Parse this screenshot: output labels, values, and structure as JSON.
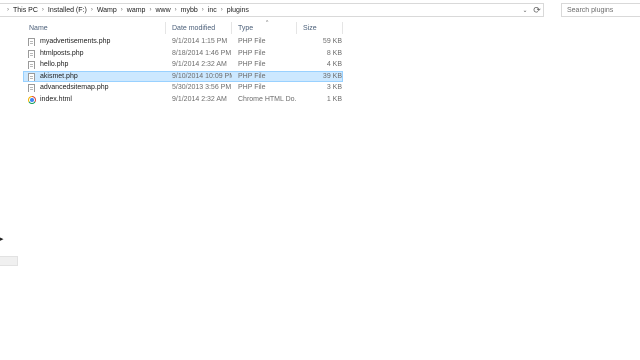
{
  "breadcrumbs": [
    "This PC",
    "Installed (F:)",
    "Wamp",
    "wamp",
    "www",
    "mybb",
    "inc",
    "plugins"
  ],
  "search": {
    "placeholder": "Search plugins"
  },
  "columns": {
    "name": "Name",
    "date": "Date modified",
    "type": "Type",
    "size": "Size"
  },
  "files": [
    {
      "name": "myadvertisements.php",
      "date": "9/1/2014 1:15 PM",
      "type": "PHP File",
      "size": "59 KB",
      "icon": "php-file-icon"
    },
    {
      "name": "htmlposts.php",
      "date": "8/18/2014 1:46 PM",
      "type": "PHP File",
      "size": "8 KB",
      "icon": "php-file-icon"
    },
    {
      "name": "hello.php",
      "date": "9/1/2014 2:32 AM",
      "type": "PHP File",
      "size": "4 KB",
      "icon": "php-file-icon"
    },
    {
      "name": "akismet.php",
      "date": "9/10/2014 10:09 PM",
      "type": "PHP File",
      "size": "39 KB",
      "icon": "php-file-icon",
      "selected": true
    },
    {
      "name": "advancedsitemap.php",
      "date": "5/30/2013 3:56 PM",
      "type": "PHP File",
      "size": "3 KB",
      "icon": "php-file-icon"
    },
    {
      "name": "index.html",
      "date": "9/1/2014 2:32 AM",
      "type": "Chrome HTML Do...",
      "size": "1 KB",
      "icon": "chrome-html-icon"
    }
  ],
  "colors": {
    "selection": "#cce8ff",
    "selection_border": "#99d1ff",
    "header_text": "#4c607a"
  }
}
